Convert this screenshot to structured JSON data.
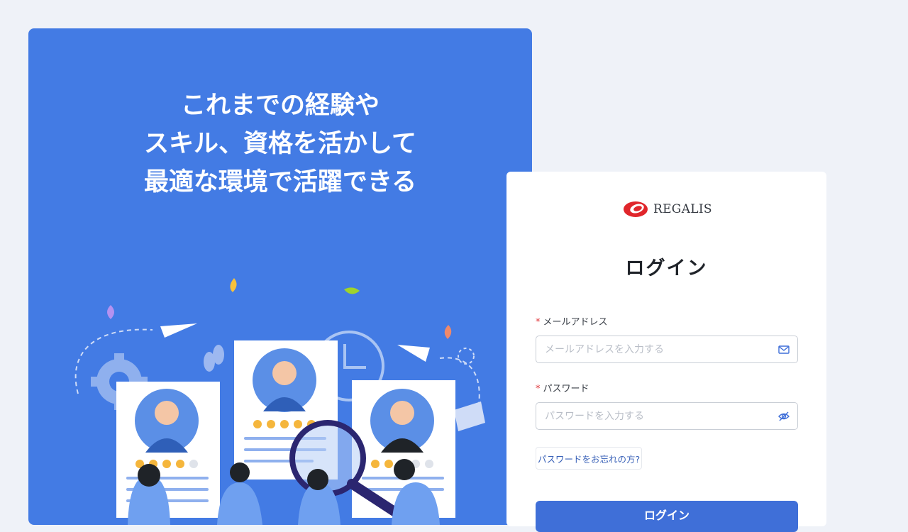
{
  "hero": {
    "headline_lines": [
      "これまでの経験や",
      "スキル、資格を活かして",
      "最適な環境で活躍できる"
    ]
  },
  "login": {
    "logo_text": "REGALIS",
    "title": "ログイン",
    "email": {
      "required_mark": "*",
      "label": "メールアドレス",
      "placeholder": "メールアドレスを入力する",
      "value": "",
      "icon": "mail-icon"
    },
    "password": {
      "required_mark": "*",
      "label": "パスワード",
      "placeholder": "パスワードを入力する",
      "value": "",
      "icon": "eye-slash-icon"
    },
    "forgot_link": "パスワードをお忘れの方?",
    "submit_label": "ログイン"
  },
  "colors": {
    "hero_bg": "#437be4",
    "accent": "#3f6fd8",
    "logo_red": "#e0262b",
    "page_bg": "#eff2f8"
  }
}
